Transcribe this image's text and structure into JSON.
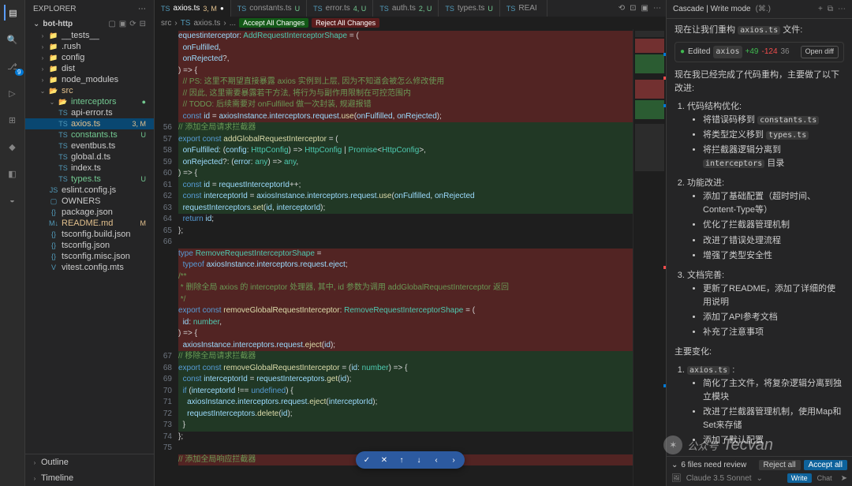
{
  "activity_icons": [
    "files",
    "search",
    "branch",
    "debug",
    "extensions",
    "python",
    "remote",
    "docker"
  ],
  "explorer": {
    "title": "Explorer",
    "project": "bot-http",
    "tree": [
      {
        "l": "__tests__",
        "d": 1,
        "i": "📁",
        "chev": "›",
        "cls": ""
      },
      {
        "l": ".rush",
        "d": 1,
        "i": "📁",
        "chev": "›",
        "cls": ""
      },
      {
        "l": "config",
        "d": 1,
        "i": "📁",
        "chev": "›",
        "cls": ""
      },
      {
        "l": "dist",
        "d": 1,
        "i": "📁",
        "chev": "›",
        "cls": "dim"
      },
      {
        "l": "node_modules",
        "d": 1,
        "i": "📁",
        "chev": "›",
        "cls": "dim"
      },
      {
        "l": "src",
        "d": 1,
        "i": "📂",
        "chev": "⌄",
        "cls": "mod"
      },
      {
        "l": "interceptors",
        "d": 2,
        "i": "📂",
        "chev": "⌄",
        "cls": "unt",
        "s": "●"
      },
      {
        "l": "api-error.ts",
        "d": 2,
        "i": "TS",
        "chev": "",
        "cls": ""
      },
      {
        "l": "axios.ts",
        "d": 2,
        "i": "TS",
        "chev": "",
        "cls": "mod sel",
        "s": "3, M"
      },
      {
        "l": "constants.ts",
        "d": 2,
        "i": "TS",
        "chev": "",
        "cls": "unt",
        "s": "U"
      },
      {
        "l": "eventbus.ts",
        "d": 2,
        "i": "TS",
        "chev": "",
        "cls": ""
      },
      {
        "l": "global.d.ts",
        "d": 2,
        "i": "TS",
        "chev": "",
        "cls": ""
      },
      {
        "l": "index.ts",
        "d": 2,
        "i": "TS",
        "chev": "",
        "cls": ""
      },
      {
        "l": "types.ts",
        "d": 2,
        "i": "TS",
        "chev": "",
        "cls": "unt",
        "s": "U"
      },
      {
        "l": "eslint.config.js",
        "d": 1,
        "i": "JS",
        "chev": "",
        "cls": ""
      },
      {
        "l": "OWNERS",
        "d": 1,
        "i": "▢",
        "chev": "",
        "cls": ""
      },
      {
        "l": "package.json",
        "d": 1,
        "i": "{}",
        "chev": "",
        "cls": ""
      },
      {
        "l": "README.md",
        "d": 1,
        "i": "M↓",
        "chev": "",
        "cls": "mod",
        "s": "M"
      },
      {
        "l": "tsconfig.build.json",
        "d": 1,
        "i": "{}",
        "chev": "",
        "cls": ""
      },
      {
        "l": "tsconfig.json",
        "d": 1,
        "i": "{}",
        "chev": "",
        "cls": ""
      },
      {
        "l": "tsconfig.misc.json",
        "d": 1,
        "i": "{}",
        "chev": "",
        "cls": ""
      },
      {
        "l": "vitest.config.mts",
        "d": 1,
        "i": "V",
        "chev": "",
        "cls": ""
      }
    ],
    "outline": "Outline",
    "timeline": "Timeline"
  },
  "tabs": [
    {
      "l": "axios.ts",
      "suf": "3, M",
      "sufc": "#e2c08d",
      "a": true,
      "dot": "●"
    },
    {
      "l": "constants.ts",
      "suf": "U",
      "sufc": "#73c991"
    },
    {
      "l": "error.ts",
      "suf": "4, U",
      "sufc": "#73c991"
    },
    {
      "l": "auth.ts",
      "suf": "2, U",
      "sufc": "#73c991"
    },
    {
      "l": "types.ts",
      "suf": "U",
      "sufc": "#73c991"
    },
    {
      "l": "REAI",
      "suf": "",
      "sufc": ""
    }
  ],
  "crumbs": {
    "a": "src",
    "b": "axios.ts",
    "c": "...",
    "chip1": "Accept All Changes",
    "chip2": "Reject All Changes"
  },
  "code": {
    "frag_top": [
      {
        "b": "del",
        "t": "<span class='c-id'>equestinterceptor</span><span class='c-pn'>: </span><span class='c-ty'>AddRequestInterceptorShape</span><span class='c-pn'> = (</span>"
      },
      {
        "b": "del",
        "t": "  <span class='c-id'>onFulfilled</span><span class='c-pn'>,</span>"
      },
      {
        "b": "del",
        "t": "  <span class='c-id'>onRejected</span><span class='c-pn'>?,</span>"
      },
      {
        "b": "del",
        "t": "<span class='c-pn'>) =&gt; {</span>"
      },
      {
        "b": "del",
        "t": "  <span class='c-cm'>// PS: 这里不期望直接暴露 axios 实例到上层, 因为不知道会被怎么修改使用</span>"
      },
      {
        "b": "del",
        "t": "  <span class='c-cm'>// 因此, 这里需要暴露若干方法, 将行为与副作用限制在可控范围内</span>"
      },
      {
        "b": "del",
        "t": "  <span class='c-cm'>// TODO: 后续需要对 onFulfilled 做一次封装, 规避报错</span>"
      },
      {
        "b": "del",
        "t": "  <span class='c-kw'>const</span> <span class='c-id'>id</span> <span class='c-pn'>=</span> <span class='c-id'>axiosInstance</span><span class='c-pn'>.</span><span class='c-id'>interceptors</span><span class='c-pn'>.</span><span class='c-id'>request</span><span class='c-pn'>.</span><span class='c-fn'>use</span><span class='c-pn'>(</span><span class='c-id'>onFulfilled</span><span class='c-pn'>, </span><span class='c-id'>onRejected</span><span class='c-pn'>);</span>"
      }
    ],
    "lines": [
      {
        "n": 56,
        "b": "add",
        "t": "<span class='c-cm'>// 添加全局请求拦截器</span>"
      },
      {
        "n": 57,
        "b": "add",
        "t": "<span class='c-kw'>export const</span> <span class='c-fn'>addGlobalRequestInterceptor</span> <span class='c-pn'>= (</span>"
      },
      {
        "n": 58,
        "b": "add",
        "t": "  <span class='c-id'>onFulfilled</span><span class='c-pn'>: (</span><span class='c-id'>config</span><span class='c-pn'>: </span><span class='c-ty'>HttpConfig</span><span class='c-pn'>) =&gt; </span><span class='c-ty'>HttpConfig</span><span class='c-pn'> | </span><span class='c-ty'>Promise</span><span class='c-pn'>&lt;</span><span class='c-ty'>HttpConfig</span><span class='c-pn'>&gt;,</span>"
      },
      {
        "n": 59,
        "b": "add",
        "t": "  <span class='c-id'>onRejected</span><span class='c-pn'>?: (</span><span class='c-id'>error</span><span class='c-pn'>: </span><span class='c-ty'>any</span><span class='c-pn'>) =&gt; </span><span class='c-ty'>any</span><span class='c-pn'>,</span>"
      },
      {
        "n": 60,
        "b": "add",
        "t": "<span class='c-pn'>) =&gt; {</span>"
      },
      {
        "n": 61,
        "b": "add",
        "t": "  <span class='c-kw'>const</span> <span class='c-id'>id</span> <span class='c-pn'>= </span><span class='c-id'>requestInterceptorId</span><span class='c-pn'>++;</span>"
      },
      {
        "n": 62,
        "b": "add",
        "t": "  <span class='c-kw'>const</span> <span class='c-id'>interceptorId</span> <span class='c-pn'>= </span><span class='c-id'>axiosInstance</span><span class='c-pn'>.</span><span class='c-id'>interceptors</span><span class='c-pn'>.</span><span class='c-id'>request</span><span class='c-pn'>.</span><span class='c-fn'>use</span><span class='c-pn'>(</span><span class='c-id'>onFulfilled</span><span class='c-pn'>, </span><span class='c-id'>onRejected</span>"
      },
      {
        "n": 63,
        "b": "add",
        "t": "  <span class='c-id'>requestInterceptors</span><span class='c-pn'>.</span><span class='c-fn'>set</span><span class='c-pn'>(</span><span class='c-id'>id</span><span class='c-pn'>, </span><span class='c-id'>interceptorId</span><span class='c-pn'>);</span>"
      },
      {
        "n": 64,
        "b": "",
        "t": "  <span class='c-kw'>return</span> <span class='c-id'>id</span><span class='c-pn'>;</span>"
      },
      {
        "n": 65,
        "b": "",
        "t": "<span class='c-pn'>};</span>"
      },
      {
        "n": 66,
        "b": "",
        "t": ""
      },
      {
        "n": "",
        "b": "del",
        "t": "<span class='c-kw'>type</span> <span class='c-ty'>RemoveRequestInterceptorShape</span> <span class='c-pn'>=</span>"
      },
      {
        "n": "",
        "b": "del",
        "t": "  <span class='c-kw'>typeof</span> <span class='c-id'>axiosInstance</span><span class='c-pn'>.</span><span class='c-id'>interceptors</span><span class='c-pn'>.</span><span class='c-id'>request</span><span class='c-pn'>.</span><span class='c-id'>eject</span><span class='c-pn'>;</span>"
      },
      {
        "n": "",
        "b": "del",
        "t": "<span class='c-cm'>/**</span>"
      },
      {
        "n": "",
        "b": "del",
        "t": "<span class='c-cm'> * 删除全局 axios 的 interceptor 处理器, 其中, id 参数为调用 addGlobalRequestInterceptor 返回</span>"
      },
      {
        "n": "",
        "b": "del",
        "t": "<span class='c-cm'> */</span>"
      },
      {
        "n": "",
        "b": "del",
        "t": "<span class='c-kw'>export const</span> <span class='c-fn'>removeGlobalRequestInterceptor</span><span class='c-pn'>: </span><span class='c-ty'>RemoveRequestInterceptorShape</span> <span class='c-pn'>= (</span>"
      },
      {
        "n": "",
        "b": "del",
        "t": "  <span class='c-id'>id</span><span class='c-pn'>: </span><span class='c-ty'>number</span><span class='c-pn'>,</span>"
      },
      {
        "n": "",
        "b": "del",
        "t": "<span class='c-pn'>) =&gt; {</span>"
      },
      {
        "n": "",
        "b": "del",
        "t": "  <span class='c-id'>axiosInstance</span><span class='c-pn'>.</span><span class='c-id'>interceptors</span><span class='c-pn'>.</span><span class='c-id'>request</span><span class='c-pn'>.</span><span class='c-fn'>eject</span><span class='c-pn'>(</span><span class='c-id'>id</span><span class='c-pn'>);</span>"
      },
      {
        "n": 67,
        "b": "add",
        "t": "<span class='c-cm'>// 移除全局请求拦截器</span>"
      },
      {
        "n": 68,
        "b": "add",
        "t": "<span class='c-kw'>export const</span> <span class='c-fn'>removeGlobalRequestInterceptor</span> <span class='c-pn'>= (</span><span class='c-id'>id</span><span class='c-pn'>: </span><span class='c-ty'>number</span><span class='c-pn'>) =&gt; {</span>"
      },
      {
        "n": 69,
        "b": "add",
        "t": "  <span class='c-kw'>const</span> <span class='c-id'>interceptorId</span> <span class='c-pn'>= </span><span class='c-id'>requestInterceptors</span><span class='c-pn'>.</span><span class='c-fn'>get</span><span class='c-pn'>(</span><span class='c-id'>id</span><span class='c-pn'>);</span>"
      },
      {
        "n": 70,
        "b": "add",
        "t": "  <span class='c-kw'>if</span> <span class='c-pn'>(</span><span class='c-id'>interceptorId</span> <span class='c-pn'>!== </span><span class='c-kw'>undefined</span><span class='c-pn'>) {</span>"
      },
      {
        "n": 71,
        "b": "add",
        "t": "    <span class='c-id'>axiosInstance</span><span class='c-pn'>.</span><span class='c-id'>interceptors</span><span class='c-pn'>.</span><span class='c-id'>request</span><span class='c-pn'>.</span><span class='c-fn'>eject</span><span class='c-pn'>(</span><span class='c-id'>interceptorId</span><span class='c-pn'>);</span>"
      },
      {
        "n": 72,
        "b": "add",
        "t": "    <span class='c-id'>requestInterceptors</span><span class='c-pn'>.</span><span class='c-fn'>delete</span><span class='c-pn'>(</span><span class='c-id'>id</span><span class='c-pn'>);</span>"
      },
      {
        "n": 73,
        "b": "add",
        "t": "  <span class='c-pn'>}</span>"
      },
      {
        "n": 74,
        "b": "",
        "t": "<span class='c-pn'>};</span>"
      },
      {
        "n": 75,
        "b": "",
        "t": ""
      },
      {
        "n": "",
        "b": "del",
        "t": "<span class='c-cm'>// 添加全局响应拦截器</span>"
      }
    ]
  },
  "cascade": {
    "title": "Cascade | Write mode",
    "shortcut": "(⌘.)",
    "intro_a": "现在让我们重构",
    "intro_b": "axios.ts",
    "intro_c": "文件:",
    "edit": {
      "label": "Edited",
      "file": "axios",
      "plus": "+49",
      "minus": "-124",
      "other": "36",
      "btn": "Open diff"
    },
    "done": "现在我已经完成了代码重构，主要做了以下改进:",
    "s1": {
      "h": "代码结构优化:",
      "items": [
        [
          "将错误码移到 ",
          "constants.ts"
        ],
        [
          "将类型定义移到 ",
          "types.ts"
        ],
        [
          "将拦截器逻辑分离到 ",
          "interceptors",
          " 目录"
        ]
      ]
    },
    "s2": {
      "h": "功能改进:",
      "items": [
        "添加了基础配置（超时时间、Content-Type等）",
        "优化了拦截器管理机制",
        "改进了错误处理流程",
        "增强了类型安全性"
      ]
    },
    "s3": {
      "h": "文档完善:",
      "items": [
        "更新了README，添加了详细的使用说明",
        "添加了API参考文档",
        "补充了注意事项"
      ]
    },
    "changes_h": "主要变化:",
    "changes": {
      "file": "axios.ts",
      "items": [
        "简化了主文件，将复杂逻辑分离到独立模块",
        "改进了拦截器管理机制，使用Map和Set来存储",
        "添加了默认配置"
      ]
    },
    "review": {
      "count": "6 files need review",
      "reject": "Reject all",
      "accept": "Accept all"
    },
    "model": "Claude 3.5 Sonnet",
    "modes": [
      "Write",
      "Chat"
    ]
  },
  "watermark": {
    "pre": "公众号",
    "name": "Tecvan"
  }
}
